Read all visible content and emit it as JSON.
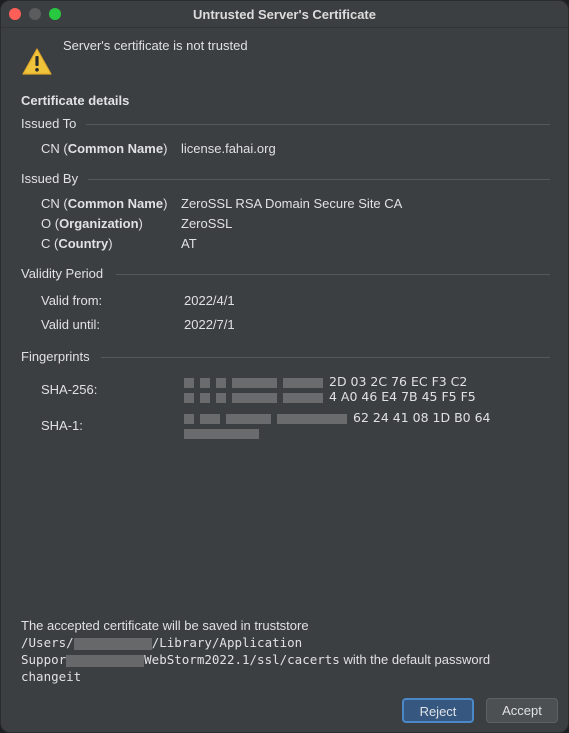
{
  "window": {
    "title": "Untrusted Server's Certificate"
  },
  "warning": {
    "message": "Server's certificate is not trusted",
    "icon": "warning-icon"
  },
  "details_title": "Certificate details",
  "issued_to": {
    "label": "Issued To",
    "cn_key_prefix": "CN (",
    "cn_key_bold": "Common Name",
    "cn_key_suffix": ")",
    "cn_value": "license.fahai.org"
  },
  "issued_by": {
    "label": "Issued By",
    "cn_key_prefix": "CN (",
    "cn_key_bold": "Common Name",
    "cn_key_suffix": ")",
    "cn_value": "ZeroSSL RSA Domain Secure Site CA",
    "o_key_prefix": "O (",
    "o_key_bold": "Organization",
    "o_key_suffix": ")",
    "o_value": "ZeroSSL",
    "c_key_prefix": "C (",
    "c_key_bold": "Country",
    "c_key_suffix": ")",
    "c_value": "AT"
  },
  "validity": {
    "label": "Validity Period",
    "from_key": "Valid from:",
    "from_value": "2022/4/1",
    "until_key": "Valid until:",
    "until_value": "2022/7/1"
  },
  "fingerprints": {
    "label": "Fingerprints",
    "sha256_key": "SHA-256:",
    "sha256_line1_tail": "2D 03 2C 76 EC F3 C2",
    "sha256_line2_tail": "4 A0 46 E4 7B 45 F5 F5",
    "sha1_key": "SHA-1:",
    "sha1_line1_tail": "62 24 41 08 1D B0 64"
  },
  "footer": {
    "line1": "The accepted certificate will be saved in truststore",
    "line2_a": "/Users/",
    "line2_b": "/Library/Application",
    "line3_a": "Suppor",
    "line3_b": "WebStorm2022.1/ssl/cacerts",
    "line3_c": " with the default password",
    "line4": "changeit"
  },
  "buttons": {
    "reject": "Reject",
    "accept": "Accept"
  },
  "colors": {
    "primary_button": "#365880",
    "primary_border": "#4a88c7",
    "background": "#3c3f41"
  }
}
